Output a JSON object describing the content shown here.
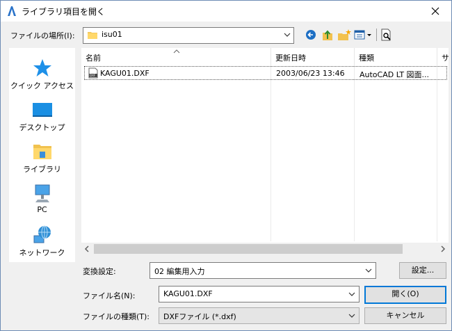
{
  "window": {
    "title": "ライブラリ項目を開く",
    "close_icon": "close-icon"
  },
  "location": {
    "label": "ファイルの場所(I):",
    "value": "isu01"
  },
  "places": [
    {
      "label": "クイック アクセス",
      "icon": "quick-access-star-icon"
    },
    {
      "label": "デスクトップ",
      "icon": "desktop-icon"
    },
    {
      "label": "ライブラリ",
      "icon": "library-folder-icon"
    },
    {
      "label": "PC",
      "icon": "pc-icon"
    },
    {
      "label": "ネットワーク",
      "icon": "network-globe-icon"
    }
  ],
  "list": {
    "columns": [
      "名前",
      "更新日時",
      "種類",
      "サ"
    ],
    "rows": [
      {
        "name": "KAGU01.DXF",
        "modified": "2003/06/23 13:46",
        "type": "AutoCAD LT 図面..."
      }
    ]
  },
  "conversion": {
    "label": "変換設定:",
    "value": "02 編集用入力",
    "settings_button": "設定..."
  },
  "filename": {
    "label": "ファイル名(N):",
    "value": "KAGU01.DXF",
    "open_button": "開く(O)"
  },
  "filetype": {
    "label": "ファイルの種類(T):",
    "value": "DXFファイル (*.dxf)",
    "cancel_button": "キャンセル"
  },
  "colors": {
    "accent": "#0078d7",
    "selection_border": "#555555"
  }
}
